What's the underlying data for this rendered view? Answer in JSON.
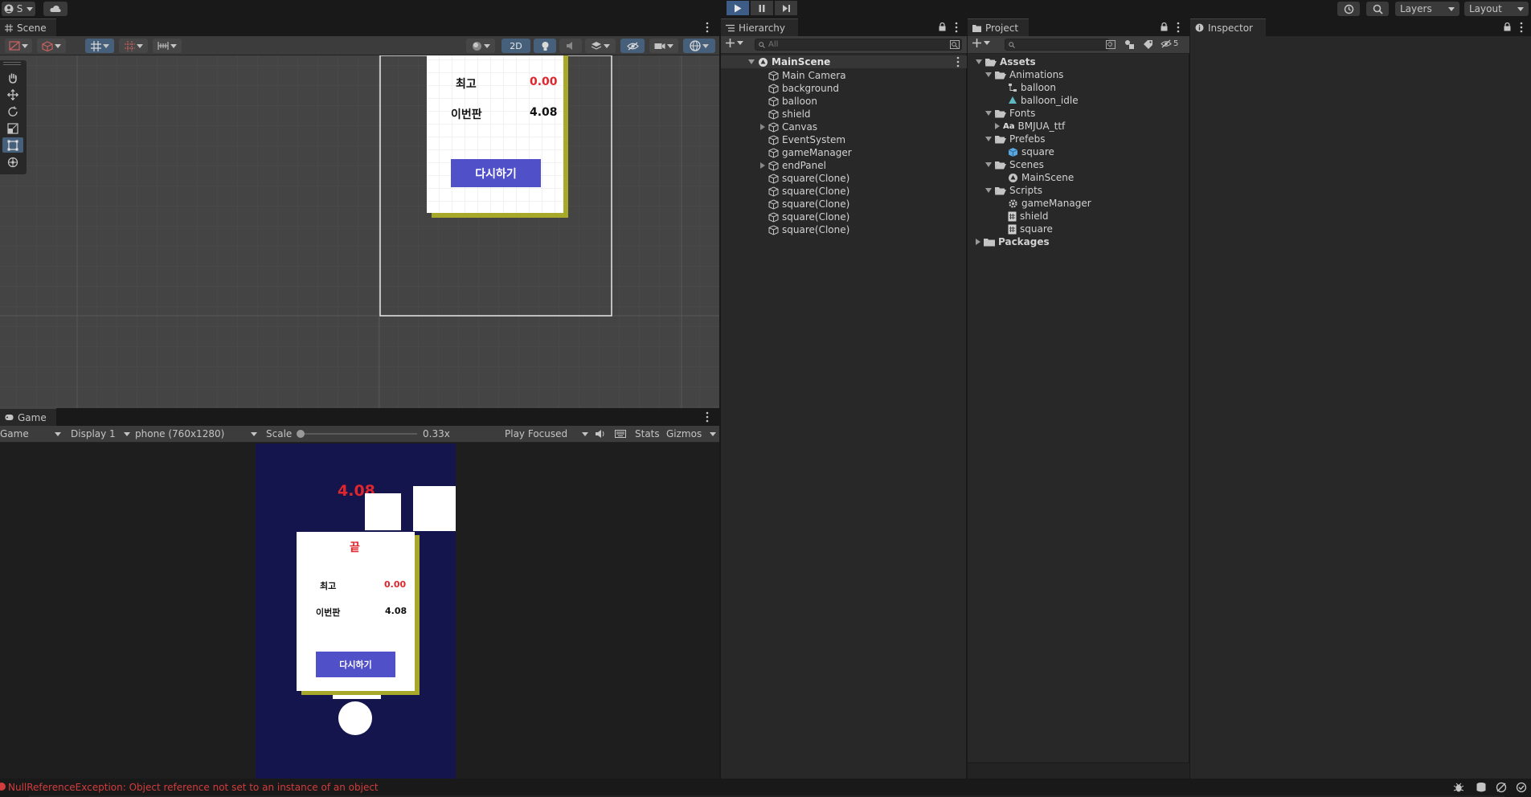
{
  "topbar": {
    "account_label": "S",
    "layers_label": "Layers",
    "layout_label": "Layout"
  },
  "scene": {
    "tab_label": "Scene",
    "mode_2d": "2D",
    "panel": {
      "best_label": "최고",
      "best_value": "0.00",
      "current_label": "이번판",
      "current_value": "4.08",
      "retry_label": "다시하기"
    }
  },
  "game": {
    "tab_label": "Game",
    "view_label": "Game",
    "display_label": "Display 1",
    "resolution_label": "phone (760x1280)",
    "scale_label": "Scale",
    "scale_value": "0.33x",
    "play_focused_label": "Play Focused",
    "stats_label": "Stats",
    "gizmos_label": "Gizmos",
    "score": "4.08",
    "panel": {
      "title": "끝",
      "best_label": "최고",
      "best_value": "0.00",
      "current_label": "이번판",
      "current_value": "4.08",
      "retry_label": "다시하기"
    }
  },
  "hierarchy": {
    "tab_label": "Hierarchy",
    "search_placeholder": "All",
    "scene_name": "MainScene",
    "items": [
      {
        "label": "Main Camera",
        "expandable": false
      },
      {
        "label": "background",
        "expandable": false
      },
      {
        "label": "balloon",
        "expandable": false
      },
      {
        "label": "shield",
        "expandable": false
      },
      {
        "label": "Canvas",
        "expandable": true
      },
      {
        "label": "EventSystem",
        "expandable": false
      },
      {
        "label": "gameManager",
        "expandable": false
      },
      {
        "label": "endPanel",
        "expandable": true
      },
      {
        "label": "square(Clone)",
        "expandable": false
      },
      {
        "label": "square(Clone)",
        "expandable": false
      },
      {
        "label": "square(Clone)",
        "expandable": false
      },
      {
        "label": "square(Clone)",
        "expandable": false
      },
      {
        "label": "square(Clone)",
        "expandable": false
      }
    ]
  },
  "project": {
    "tab_label": "Project",
    "hidden_count": "5",
    "tree": {
      "assets": "Assets",
      "animations": "Animations",
      "anim_balloon": "balloon",
      "anim_balloon_idle": "balloon_idle",
      "fonts": "Fonts",
      "font_prefix": "Aa",
      "font_bmjua": "BMJUA_ttf",
      "prefabs": "Prefebs",
      "prefab_square": "square",
      "scenes": "Scenes",
      "scene_main": "MainScene",
      "scripts": "Scripts",
      "script_gamemanager": "gameManager",
      "script_shield": "shield",
      "script_square": "square",
      "packages": "Packages"
    }
  },
  "inspector": {
    "tab_label": "Inspector"
  },
  "statusbar": {
    "error_message": "NullReferenceException: Object reference not set to an instance of an object"
  },
  "colors": {
    "accent_blue": "#3d5d87",
    "game_bg": "#15154d",
    "score_red": "#e0262d",
    "button_purple": "#5050c8",
    "panel_shadow": "#a8a82a",
    "error_red": "#d23c3c"
  }
}
